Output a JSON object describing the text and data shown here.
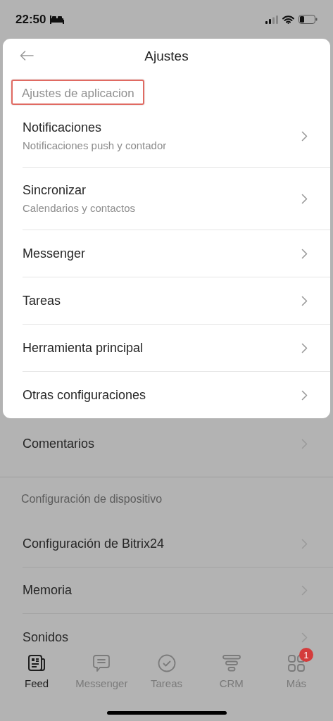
{
  "status_bar": {
    "time": "22:50"
  },
  "sheet": {
    "title": "Ajustes",
    "section_label": {
      "text": "Ajustes de aplicacion",
      "highlighted": true
    },
    "items": [
      {
        "title": "Notificaciones",
        "subtitle": "Notificaciones push y contador"
      },
      {
        "title": "Sincronizar",
        "subtitle": "Calendarios y contactos"
      },
      {
        "title": "Messenger"
      },
      {
        "title": "Tareas"
      },
      {
        "title": "Herramienta principal"
      },
      {
        "title": "Otras configuraciones"
      }
    ]
  },
  "background_list": [
    {
      "kind": "row",
      "title": "Comentarios"
    },
    {
      "kind": "header",
      "title": "Configuración de dispositivo"
    },
    {
      "kind": "row",
      "title": "Configuración de Bitrix24"
    },
    {
      "kind": "row",
      "title": "Memoria"
    },
    {
      "kind": "row",
      "title": "Sonidos"
    }
  ],
  "tab_bar": [
    {
      "label": "Feed",
      "selected": true
    },
    {
      "label": "Messenger",
      "selected": false
    },
    {
      "label": "Tareas",
      "selected": false
    },
    {
      "label": "CRM",
      "selected": false
    },
    {
      "label": "Más",
      "selected": false,
      "badge": "1"
    }
  ]
}
